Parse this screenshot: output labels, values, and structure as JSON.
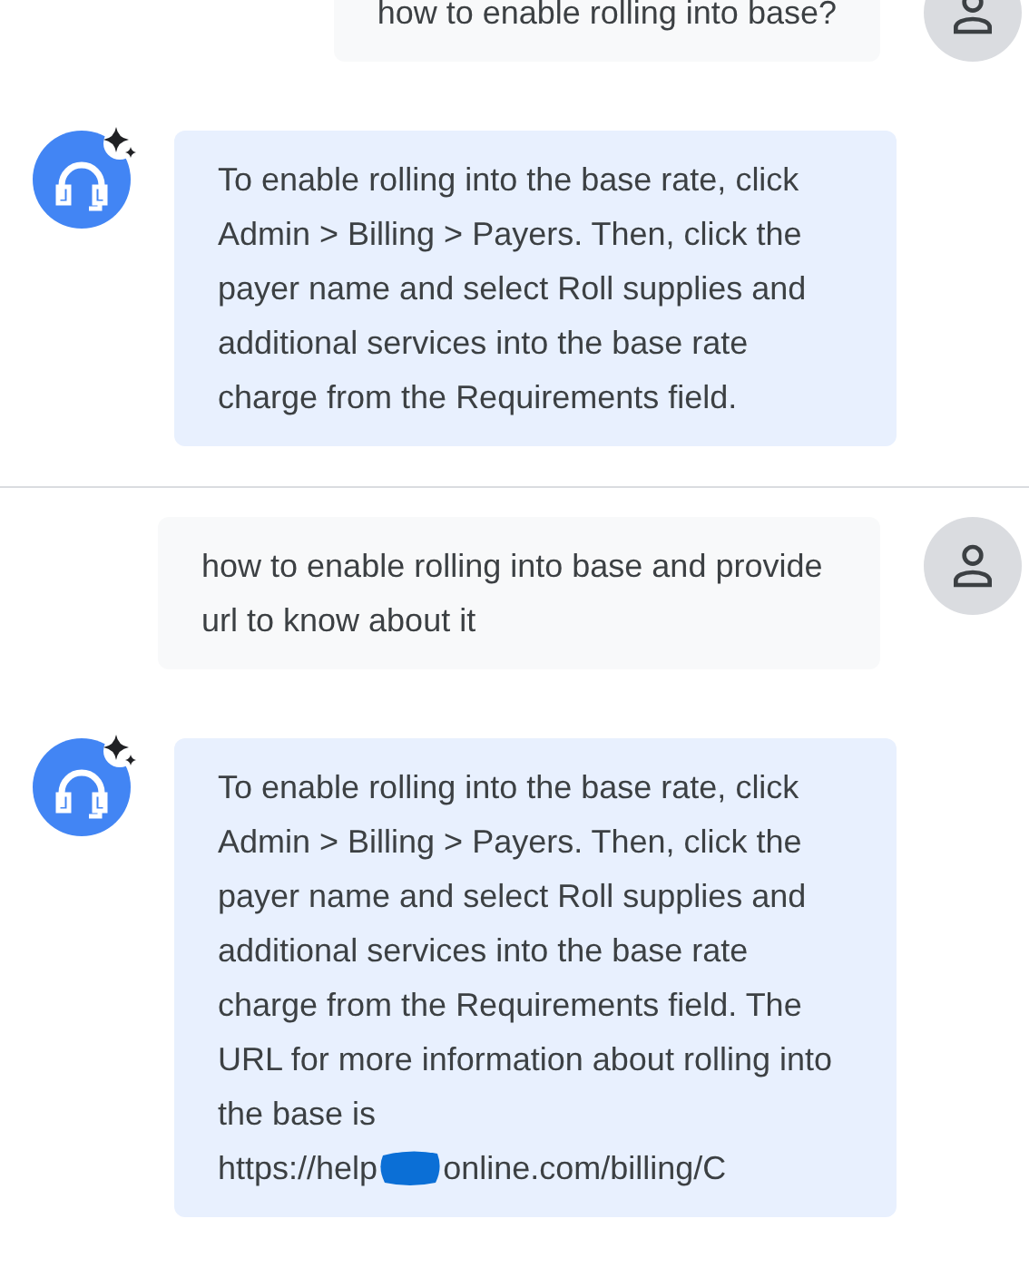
{
  "turns": [
    {
      "question": "how to enable rolling into base?",
      "answer": {
        "text": "To enable rolling into the base rate, click Admin > Billing > Payers. Then, click the payer name and select Roll supplies and additional services into the base rate charge from the Requirements field."
      }
    },
    {
      "question": "how to enable rolling into base and provide url to know about it",
      "answer": {
        "text": "To enable rolling into the base rate, click Admin > Billing > Payers. Then, click the payer name and select Roll supplies and additional services into the base rate charge from the Requirements field. The URL for more information about rolling into the base is",
        "url_start": "https://help",
        "redacted": true,
        "url_end": "online.com/billing/C"
      }
    }
  ]
}
